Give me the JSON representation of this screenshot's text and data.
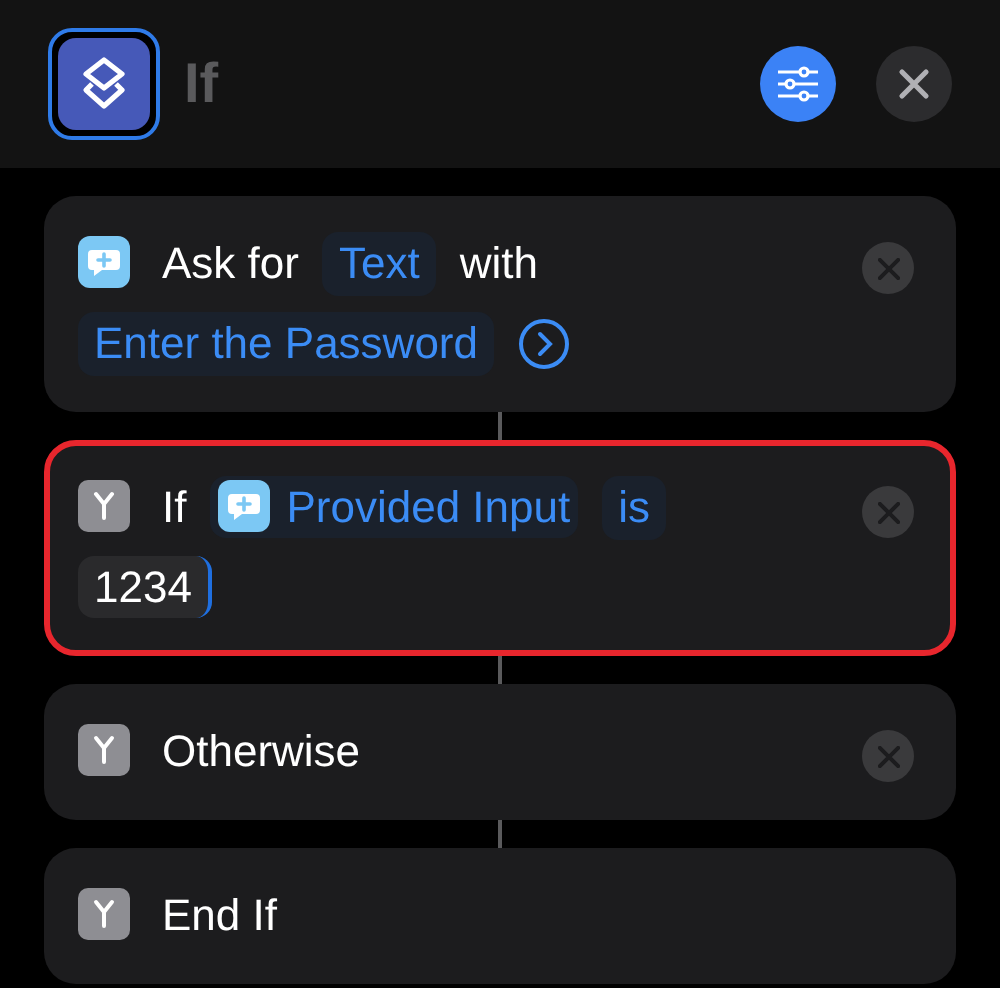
{
  "header": {
    "title": "If"
  },
  "actions": [
    {
      "kind": "ask",
      "removable": true,
      "highlighted": false,
      "show_more": true,
      "parts": [
        {
          "kind": "text",
          "text": "Ask for"
        },
        {
          "kind": "token",
          "text": "Text"
        },
        {
          "kind": "text",
          "text": "with"
        },
        {
          "kind": "token",
          "text": "Enter the Password"
        }
      ]
    },
    {
      "kind": "branch",
      "removable": true,
      "highlighted": true,
      "show_more": false,
      "parts": [
        {
          "kind": "text",
          "text": "If"
        },
        {
          "kind": "variable",
          "text": "Provided Input"
        },
        {
          "kind": "token",
          "text": "is"
        },
        {
          "kind": "input",
          "text": "1234"
        }
      ]
    },
    {
      "kind": "branch",
      "removable": true,
      "highlighted": false,
      "show_more": false,
      "parts": [
        {
          "kind": "text",
          "text": "Otherwise"
        }
      ]
    },
    {
      "kind": "branch",
      "removable": false,
      "highlighted": false,
      "show_more": false,
      "parts": [
        {
          "kind": "text",
          "text": "End If"
        }
      ]
    }
  ]
}
